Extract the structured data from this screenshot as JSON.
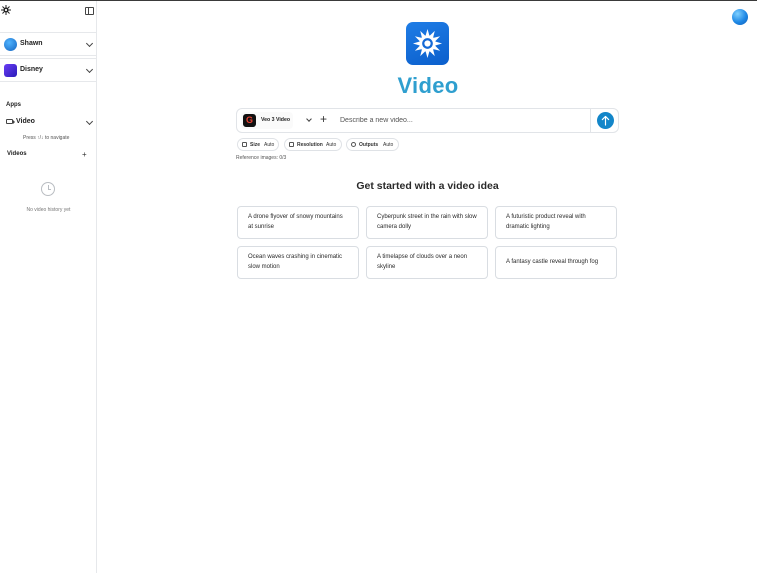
{
  "sidebar": {
    "user_name": "Shawn",
    "org_name": "Disney",
    "section_label": "Apps",
    "app_name": "Video",
    "navigate_hint": "Press ↑/↓ to navigate",
    "videos_label": "Videos",
    "empty_text": "No video history yet"
  },
  "main": {
    "title": "Video",
    "model_name": "Veo 3 Video",
    "prompt_placeholder": "Describe a new video...",
    "options": {
      "size_label": "Size",
      "size_value": "Auto",
      "resolution_label": "Resolution",
      "resolution_value": "Auto",
      "outputs_label": "Outputs",
      "outputs_value": "Auto"
    },
    "reference_images": "Reference images: 0/3",
    "ideas_title": "Get started with a video idea",
    "ideas": [
      "A drone flyover of snowy mountains at sunrise",
      "Cyberpunk street in the rain with slow camera dolly",
      "A futuristic product reveal with dramatic lighting",
      "Ocean waves crashing in cinematic slow motion",
      "A timelapse of clouds over a neon skyline",
      "A fantasy castle reveal through fog"
    ]
  },
  "colors": {
    "accent": "#1386c9",
    "title": "#2f9fcf",
    "hero_icon_bg": "#1a73e8"
  },
  "icons": [
    "logo-icon",
    "collapse-sidebar-icon",
    "video-icon",
    "plus-icon",
    "clock-icon",
    "arrow-up-icon",
    "user-avatar"
  ]
}
